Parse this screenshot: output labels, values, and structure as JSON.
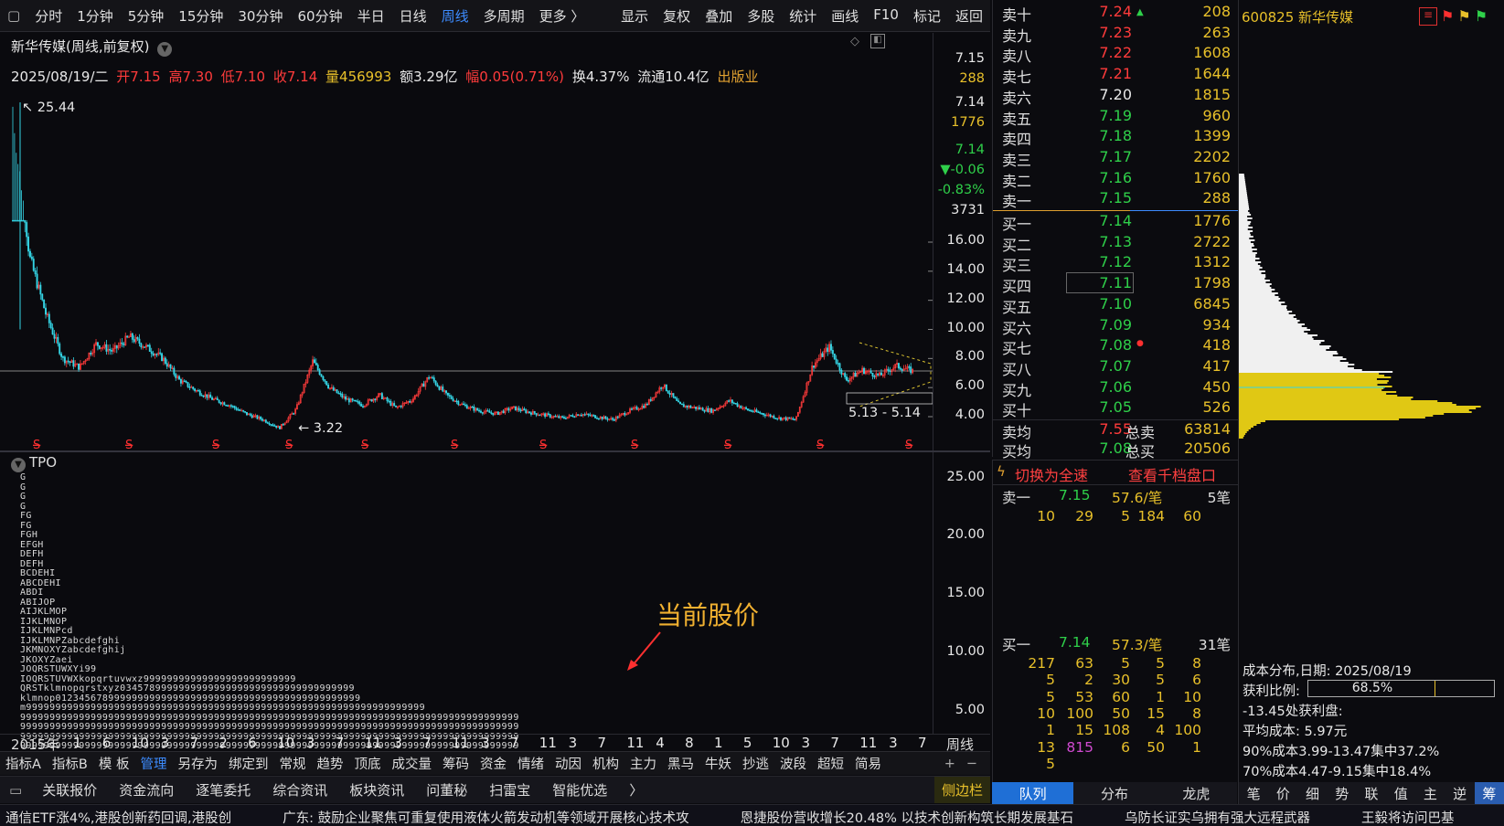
{
  "toolbar": {
    "periods": [
      "分时",
      "1分钟",
      "5分钟",
      "15分钟",
      "30分钟",
      "60分钟",
      "半日",
      "日线",
      "周线",
      "多周期",
      "更多 〉"
    ],
    "active": "周线",
    "right": [
      "显示",
      "复权",
      "叠加",
      "多股",
      "统计",
      "画线",
      "F10",
      "标记",
      "返回"
    ]
  },
  "chart": {
    "title": "新华传媒",
    "subtitle": "(周线,前复权)",
    "ohlc": {
      "date": "2025/08/19/二",
      "open": "开7.15",
      "high": "高7.30",
      "low": "低7.10",
      "close": "收7.14",
      "volume": "量456993",
      "amount": "额3.29亿",
      "change": "幅0.05(0.71%)",
      "turnover": "换4.37%",
      "float": "流通10.4亿",
      "sector": "出版业"
    },
    "side_quotes": [
      "7.15",
      "288",
      "7.14",
      "1776",
      "7.14",
      "▼-0.06",
      "-0.83%",
      "3731"
    ],
    "price_ticks": [
      "16.00",
      "14.00",
      "12.00",
      "10.00",
      "8.00",
      "6.00",
      "4.00"
    ],
    "annotations": {
      "high": "25.44",
      "low": "3.22",
      "range": "5.13 - 5.14"
    },
    "s_marker": "S"
  },
  "chart_data": {
    "type": "line",
    "title": "新华传媒",
    "xlabel": "",
    "ylabel": "",
    "ylim": [
      3,
      17
    ],
    "x_start_label": "2015年",
    "x_ticks": [
      "1",
      "6",
      "10",
      "3",
      "7",
      "2",
      "6",
      "10",
      "3",
      "7",
      "11",
      "3",
      "7",
      "11",
      "3",
      "7",
      "11",
      "3",
      "7",
      "11",
      "4",
      "8",
      "1",
      "5",
      "10",
      "3",
      "7",
      "11",
      "3",
      "7"
    ],
    "series": [
      {
        "name": "",
        "values": [
          25.44,
          15,
          11,
          8,
          7.4,
          9,
          8.5,
          9.5,
          8.8,
          8,
          6.5,
          5.8,
          5.2,
          4.8,
          4.2,
          3.8,
          3.22,
          4.5,
          7.8,
          6.0,
          5.2,
          4.8,
          5.5,
          4.6,
          5.2,
          6.8,
          5.5,
          4.8,
          4.4,
          4.2,
          4.6,
          4.3,
          4.1,
          3.9,
          4.2,
          4.0,
          3.8,
          4.4,
          4.8,
          6.2,
          4.8,
          4.6,
          4.4,
          5.1,
          4.5,
          4.2,
          3.9,
          3.8,
          7.5,
          8.8,
          6.5,
          7.2,
          6.8,
          7.5,
          7.14
        ]
      }
    ]
  },
  "tpo": {
    "label": "TPO",
    "ticks": [
      "25.00",
      "20.00",
      "15.00",
      "10.00",
      "5.00"
    ],
    "lines": [
      "G",
      "G",
      "G",
      "G",
      "FG",
      "FG",
      "FGH",
      "EFGH",
      "DEFH",
      "DEFH",
      "BCDEHI",
      "ABCDEHI",
      "ABDI",
      "ABIJOP",
      "AIJKLMOP",
      "IJKLMNOP",
      "IJKLMNPcd",
      "IJKLMNPZabcdefghi",
      "JKMNOXYZabcdefghij",
      "JKOXYZaei",
      "JOQRSTUWXYi99",
      "IOQRSTUVWXkopqrtuvwxz99999999999999999999999999",
      "QRSTklmnopqrstxyz0345789999999999999999999999999999999999",
      "klmnop0123456789999999999999999999999999999999999999999999",
      "m99999999999999999999999999999999999999999999999999999999999999999999",
      "9999999999999999999999999999999999999999999999999999999999999999999999999999999999999",
      "9999999999999999999999999999999999999999999999999999999999999999999999999999999999999",
      "9999999999999999999999999999999999999999999999999999999999999999999999999999999999999",
      "9999999999999999999999999999999999999999999999999999999999999999999999999999999999999",
      "999999999999999999999999999999999999999999999999999999999999999999999999999999999999",
      "999999999999999999999999999999999999999999999999999999999999999999"
    ],
    "callout": "当前股价",
    "period_label": "周线"
  },
  "bottom_tabs": [
    "指标A",
    "指标B",
    "模 板",
    "管理",
    "另存为",
    "绑定到",
    "常规",
    "趋势",
    "顶底",
    "成交量",
    "筹码",
    "资金",
    "情绪",
    "动因",
    "机构",
    "主力",
    "黑马",
    "牛妖",
    "抄逃",
    "波段",
    "超短",
    "简易"
  ],
  "bottom_active": "管理",
  "bottom_plus": "+",
  "bottom_minus": "−",
  "link_bar": [
    "关联报价",
    "资金流向",
    "逐笔委托",
    "综合资讯",
    "板块资讯",
    "问董秘",
    "扫雷宝",
    "智能优选",
    "〉"
  ],
  "side_bar": "侧边栏",
  "book": {
    "sell": [
      {
        "l": "卖十",
        "p": "7.24",
        "v": "208",
        "c": "red"
      },
      {
        "l": "卖九",
        "p": "7.23",
        "v": "263",
        "c": "red"
      },
      {
        "l": "卖八",
        "p": "7.22",
        "v": "1608",
        "c": "red"
      },
      {
        "l": "卖七",
        "p": "7.21",
        "v": "1644",
        "c": "red"
      },
      {
        "l": "卖六",
        "p": "7.20",
        "v": "1815",
        "c": "white"
      },
      {
        "l": "卖五",
        "p": "7.19",
        "v": "960",
        "c": "green"
      },
      {
        "l": "卖四",
        "p": "7.18",
        "v": "1399",
        "c": "green"
      },
      {
        "l": "卖三",
        "p": "7.17",
        "v": "2202",
        "c": "green"
      },
      {
        "l": "卖二",
        "p": "7.16",
        "v": "1760",
        "c": "green"
      },
      {
        "l": "卖一",
        "p": "7.15",
        "v": "288",
        "c": "green"
      }
    ],
    "buy": [
      {
        "l": "买一",
        "p": "7.14",
        "v": "1776",
        "c": "green"
      },
      {
        "l": "买二",
        "p": "7.13",
        "v": "2722",
        "c": "green"
      },
      {
        "l": "买三",
        "p": "7.12",
        "v": "1312",
        "c": "green"
      },
      {
        "l": "买四",
        "p": "7.11",
        "v": "1798",
        "c": "green"
      },
      {
        "l": "买五",
        "p": "7.10",
        "v": "6845",
        "c": "green"
      },
      {
        "l": "买六",
        "p": "7.09",
        "v": "934",
        "c": "green"
      },
      {
        "l": "买七",
        "p": "7.08",
        "v": "418",
        "c": "green"
      },
      {
        "l": "买八",
        "p": "7.07",
        "v": "417",
        "c": "green"
      },
      {
        "l": "买九",
        "p": "7.06",
        "v": "450",
        "c": "green"
      },
      {
        "l": "买十",
        "p": "7.05",
        "v": "526",
        "c": "green"
      }
    ],
    "avg_sell_label": "卖均",
    "avg_sell": "7.55",
    "total_sell_label": "总卖",
    "total_sell": "63814",
    "avg_buy_label": "买均",
    "avg_buy": "7.08",
    "total_buy_label": "总买",
    "total_buy": "20506"
  },
  "quick": {
    "switch": "切换为全速",
    "view": "查看千档盘口",
    "sell1": {
      "l": "卖一",
      "p": "7.15",
      "per": "57.6/笔",
      "n": "5笔"
    },
    "sell_queue": [
      "10",
      "29",
      "5",
      "184",
      "60"
    ],
    "buy1": {
      "l": "买一",
      "p": "7.14",
      "per": "57.3/笔",
      "n": "31笔"
    },
    "buy_queue": [
      [
        "217",
        "63",
        "5",
        "5",
        "8"
      ],
      [
        "5",
        "2",
        "30",
        "5",
        "6"
      ],
      [
        "5",
        "53",
        "60",
        "1",
        "10"
      ],
      [
        "10",
        "100",
        "50",
        "15",
        "8"
      ],
      [
        "1",
        "15",
        "108",
        "4",
        "100"
      ],
      [
        "13",
        "815",
        "6",
        "50",
        "1"
      ],
      [
        "5"
      ]
    ],
    "tabs": [
      "队列",
      "分布",
      "龙虎"
    ],
    "tab_active": "队列"
  },
  "chips": {
    "code": "600825",
    "name": "新华传媒",
    "date_line": "成本分布,日期:  2025/08/19",
    "profit_label": "获利比例:",
    "profit_value": "68.5%",
    "profit_ratio": 0.685,
    "line1": "-13.45处获利盘:",
    "line2": "平均成本:  5.97元",
    "line3": "90%成本3.99-13.47集中37.2%",
    "line4": "70%成本4.47-9.15集中18.4%",
    "tabs": [
      "笔",
      "价",
      "细",
      "势",
      "联",
      "值",
      "主",
      "逆",
      "筹"
    ],
    "tab_active": "筹"
  },
  "ticker": [
    "通信ETF涨4%,港股创新药回调,港股创",
    "广东:  鼓励企业聚焦可重复使用液体火箭发动机等领域开展核心技术攻",
    "恩捷股份营收增长20.48% 以技术创新构筑长期发展基石",
    "乌防长证实乌拥有强大远程武器",
    "王毅将访问巴基"
  ]
}
